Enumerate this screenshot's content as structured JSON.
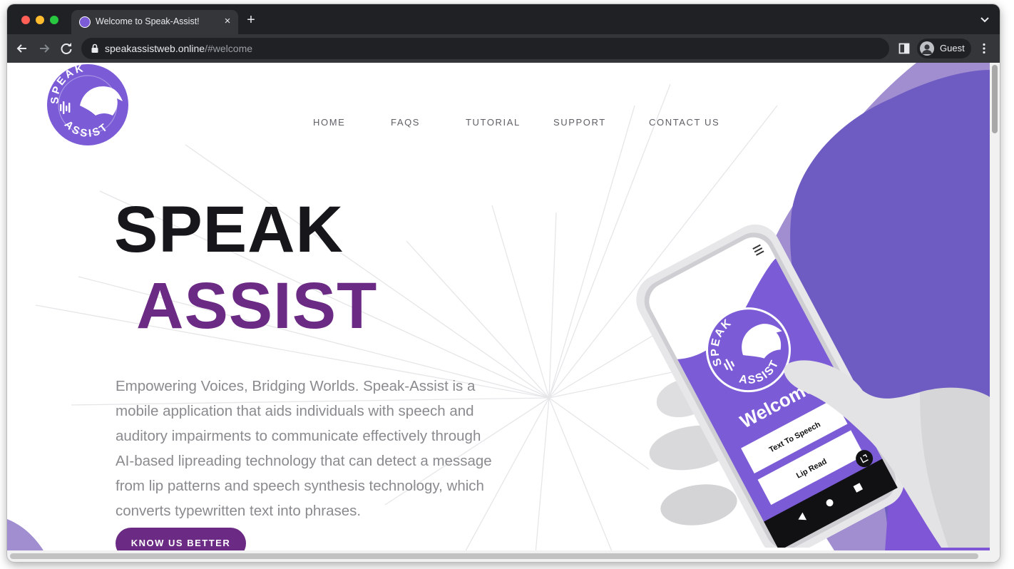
{
  "browser": {
    "tab_title": "Welcome to Speak-Assist!",
    "tab_close": "×",
    "new_tab": "+",
    "url_host": "speakassistweb.online",
    "url_path": "/#welcome",
    "profile_label": "Guest"
  },
  "site": {
    "logo_text_top": "SPEAK",
    "logo_text_bottom": "ASSIST",
    "nav": [
      "HOME",
      "FAQS",
      "TUTORIAL",
      "SUPPORT",
      "CONTACT US"
    ],
    "hero_title_line1": "SPEAK",
    "hero_title_line2": "ASSIST",
    "description": "Empowering Voices, Bridging Worlds. Speak-Assist is a mobile application that aids individuals with speech and auditory impairments to communicate effectively through AI-based lipreading technology that can detect a message from lip patterns and speech synthesis technology, which converts typewritten text into phrases.",
    "cta_label": "KNOW US BETTER"
  },
  "phone": {
    "logo_text_top": "SPEAK",
    "logo_text_bottom": "ASSIST",
    "welcome": "Welcome",
    "button_1": "Text To Speech",
    "button_2": "Lip Read"
  },
  "colors": {
    "brand_purple": "#6b2a84",
    "accent_violet": "#7b5cd6",
    "heading_dark": "#17171b",
    "body_text": "#8a8a8f"
  }
}
